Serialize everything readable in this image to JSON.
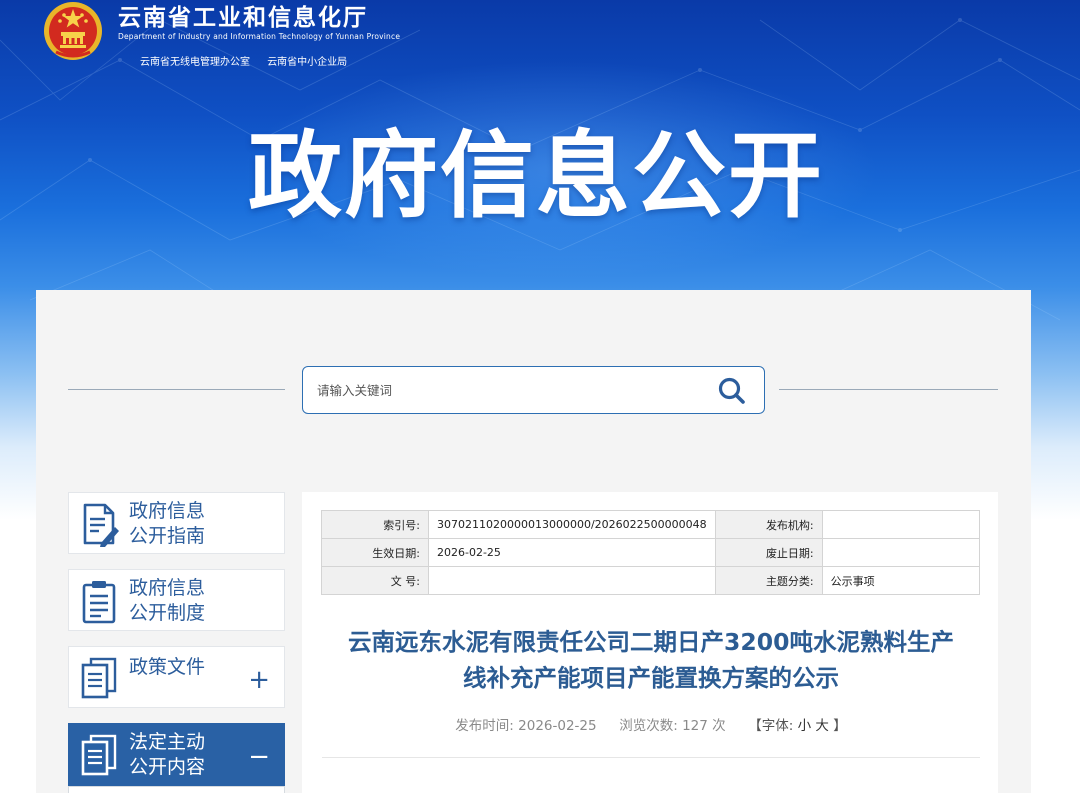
{
  "header": {
    "dept_name_cn": "云南省工业和信息化厅",
    "dept_name_en": "Department of Industry and Information Technology of Yunnan Province",
    "sub_orgs": [
      "云南省无线电管理办公室",
      "云南省中小企业局"
    ],
    "banner_title": "政府信息公开"
  },
  "search": {
    "placeholder": "请输入关键词",
    "button_icon": "search-icon"
  },
  "sidebar": {
    "items": [
      {
        "label_line1": "政府信息",
        "label_line2": "公开指南",
        "icon": "document-pen-icon",
        "toggle": ""
      },
      {
        "label_line1": "政府信息",
        "label_line2": "公开制度",
        "icon": "clipboard-list-icon",
        "toggle": ""
      },
      {
        "label_line1": "政策文件",
        "label_line2": "",
        "icon": "documents-stack-icon",
        "toggle": "+"
      },
      {
        "label_line1": "法定主动",
        "label_line2": "公开内容",
        "icon": "documents-stack-icon",
        "toggle": "−"
      }
    ]
  },
  "meta": {
    "index_label": "索引号:",
    "index_value": "3070211020000013000000/2026022500000048",
    "publisher_label": "发布机构:",
    "publisher_value": "",
    "effective_label": "生效日期:",
    "effective_value": "2026-02-25",
    "repeal_label": "废止日期:",
    "repeal_value": "",
    "docno_label": "文 号:",
    "docno_value": "",
    "topic_label": "主题分类:",
    "topic_value": "公示事项"
  },
  "article": {
    "title_line1": "云南远东水泥有限责任公司二期日产3200吨水泥熟料生产",
    "title_line2": "线补充产能项目产能置换方案的公示",
    "publish_label": "发布时间:",
    "publish_time": "2026-02-25",
    "views_label": "浏览次数:",
    "views_count": "127",
    "views_unit": "次",
    "font_label_open": "【字体:",
    "font_small": "小",
    "font_large": "大",
    "font_label_close": "】"
  },
  "colors": {
    "banner_dark": "#0a3aa8",
    "nav_text": "#2c5d9c",
    "nav_active_bg": "#2961a5",
    "title_color": "#2c5c93",
    "search_border": "#2d6fb3"
  }
}
